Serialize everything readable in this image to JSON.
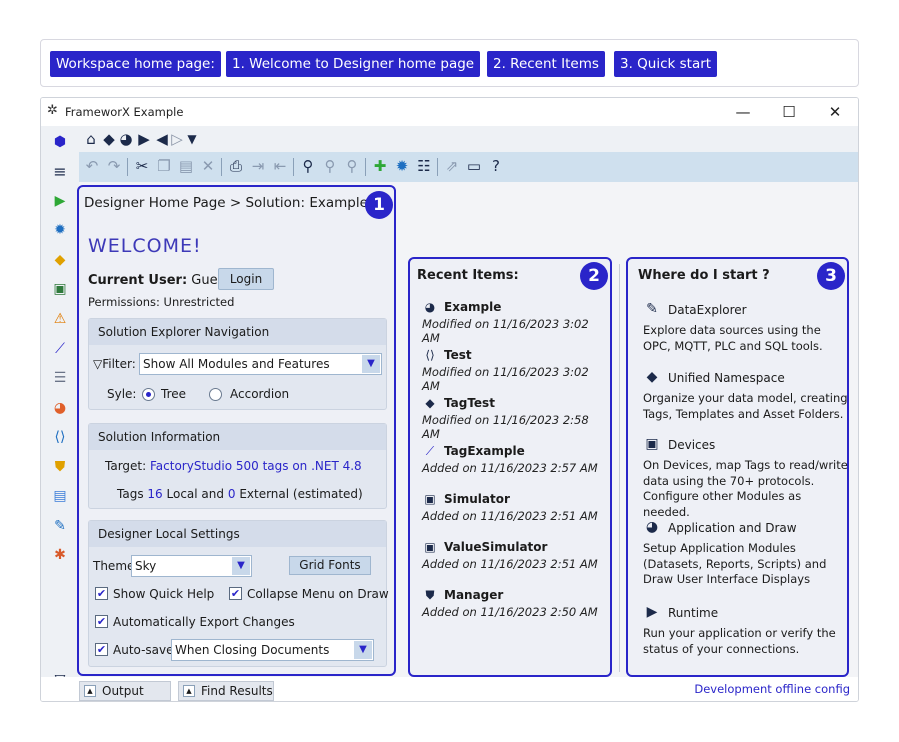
{
  "topnav": {
    "items": [
      "Workspace home page:",
      "1. Welcome to Designer home page",
      "2. Recent Items",
      "3. Quick start"
    ]
  },
  "window": {
    "title": "FrameworX Example",
    "controls": {
      "minimize": "—",
      "maximize": "☐",
      "close": "✕"
    }
  },
  "sidebar": {
    "icons": [
      "solution-icon",
      "menu-icon",
      "runtime-icon",
      "settings-icon",
      "unified-namespace-icon",
      "devices-icon",
      "alarms-icon",
      "trend-icon",
      "datasets-icon",
      "displays-icon",
      "scripts-icon",
      "security-icon",
      "reports-icon",
      "tools-icon",
      "extensions-icon"
    ]
  },
  "panel1": {
    "breadcrumb": "Designer Home Page > Solution: Example",
    "badge": "1",
    "welcome": "WELCOME!",
    "current_user_label": "Current User:",
    "current_user_value": "Guest",
    "login_label": "Login",
    "permissions": "Permissions: Unrestricted",
    "nav_group": {
      "title": "Solution Explorer Navigation",
      "filter_label": "Filter:",
      "filter_value": "Show All Modules and Features",
      "style_label": "Syle:",
      "style_options": [
        "Tree",
        "Accordion"
      ],
      "style_selected": "Tree"
    },
    "info_group": {
      "title": "Solution Information",
      "target_label": "Target:",
      "target_value": "FactoryStudio 500 tags on .NET 4.8",
      "tags_label": "Tags",
      "tags_local": "16",
      "tags_local_label": "Local and",
      "tags_external": "0",
      "tags_external_label": "External (estimated)"
    },
    "settings_group": {
      "title": "Designer Local Settings",
      "theme_label": "Theme:",
      "theme_value": "Sky",
      "grid_fonts_label": "Grid Fonts",
      "show_quick_help": "Show Quick Help",
      "collapse_menu": "Collapse Menu on Draw",
      "auto_export": "Automatically Export Changes",
      "auto_save_label": "Auto-save:",
      "auto_save_value": "When Closing Documents"
    }
  },
  "panel2": {
    "title": "Recent Items:",
    "badge": "2",
    "items": [
      {
        "name": "Example",
        "date": "Modified on 11/16/2023 3:02 AM",
        "icon": "solution-icon"
      },
      {
        "name": "Test",
        "date": "Modified on 11/16/2023 3:02 AM",
        "icon": "script-icon"
      },
      {
        "name": "TagTest",
        "date": "Modified on 11/16/2023 2:58 AM",
        "icon": "tag-icon"
      },
      {
        "name": "TagExample",
        "date": "Added on 11/16/2023 2:57 AM",
        "icon": "trend-icon"
      },
      {
        "name": "Simulator",
        "date": "Added on 11/16/2023 2:51 AM",
        "icon": "device-icon"
      },
      {
        "name": "ValueSimulator",
        "date": "Added on 11/16/2023 2:51 AM",
        "icon": "device-icon"
      },
      {
        "name": "Manager",
        "date": "Added on 11/16/2023 2:50 AM",
        "icon": "security-icon"
      }
    ]
  },
  "panel3": {
    "title": "Where do I start ?",
    "badge": "3",
    "items": [
      {
        "title": "DataExplorer",
        "desc": "Explore data sources using the  OPC, MQTT, PLC and SQL tools.",
        "icon": "wrench-icon"
      },
      {
        "title": "Unified Namespace",
        "desc": "Organize your data model, creating Tags, Templates and Asset Folders.",
        "icon": "tags-icon"
      },
      {
        "title": "Devices",
        "desc": "On Devices, map Tags to read/write data using the 70+ protocols. Configure other Modules as needed.",
        "icon": "devices-icon"
      },
      {
        "title": "Application and Draw",
        "desc": "Setup Application Modules (Datasets, Reports, Scripts) and Draw User Interface Displays",
        "icon": "palette-icon"
      },
      {
        "title": "Runtime",
        "desc": "Run your application or verify the status of your connections.",
        "icon": "runtime-icon"
      }
    ]
  },
  "bottombar": {
    "output_label": "Output",
    "find_results_label": "Find Results",
    "status": "Development offline config"
  },
  "colors": {
    "accent": "#2a25c9",
    "toolbar": "#cfe0ee",
    "sidebar": "#eef1f5"
  }
}
